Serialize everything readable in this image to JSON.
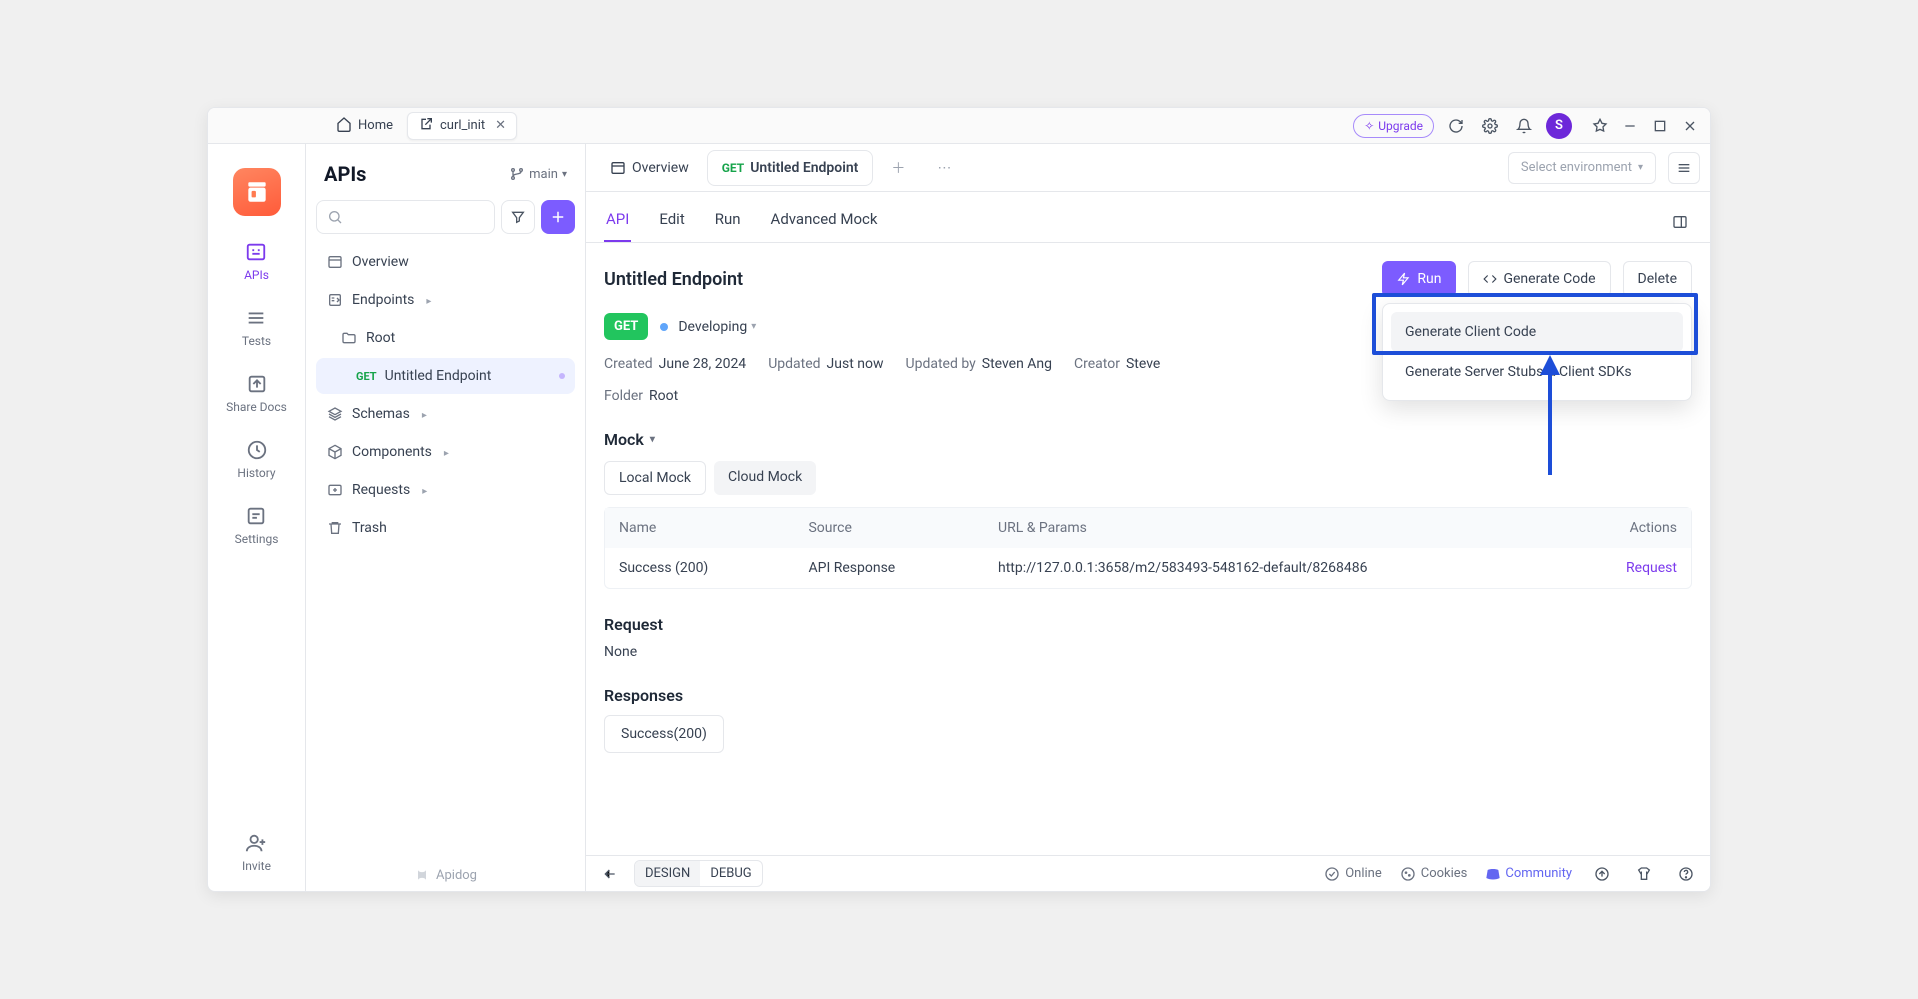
{
  "titlebar": {
    "home": "Home",
    "activeTab": "curl_init",
    "upgrade": "Upgrade",
    "avatarInitial": "S"
  },
  "rail": {
    "items": [
      "APIs",
      "Tests",
      "Share Docs",
      "History",
      "Settings",
      "Invite"
    ]
  },
  "sidebar": {
    "title": "APIs",
    "branch": "main",
    "tree": {
      "overview": "Overview",
      "endpoints": "Endpoints",
      "root": "Root",
      "endpointMethod": "GET",
      "endpointName": "Untitled Endpoint",
      "schemas": "Schemas",
      "components": "Components",
      "requests": "Requests",
      "trash": "Trash"
    },
    "brand": "Apidog"
  },
  "mainTabs": {
    "overview": "Overview",
    "endpointMethod": "GET",
    "endpointLabel": "Untitled Endpoint",
    "envPlaceholder": "Select environment"
  },
  "subtabs": [
    "API",
    "Edit",
    "Run",
    "Advanced Mock"
  ],
  "endpoint": {
    "title": "Untitled Endpoint",
    "run": "Run",
    "generate": "Generate Code",
    "delete": "Delete",
    "method": "GET",
    "status": "Developing",
    "created": {
      "label": "Created",
      "value": "June 28, 2024"
    },
    "updated": {
      "label": "Updated",
      "value": "Just now"
    },
    "updatedBy": {
      "label": "Updated by",
      "value": "Steven Ang"
    },
    "creator": {
      "label": "Creator",
      "value": "Steve"
    },
    "folder": {
      "label": "Folder",
      "value": "Root"
    }
  },
  "dropdown": {
    "item1": "Generate Client Code",
    "item2": "Generate Server Stubs & Client SDKs"
  },
  "mock": {
    "title": "Mock",
    "local": "Local Mock",
    "cloud": "Cloud Mock",
    "headers": {
      "name": "Name",
      "source": "Source",
      "url": "URL & Params",
      "actions": "Actions"
    },
    "row": {
      "name": "Success (200)",
      "source": "API Response",
      "url": "http://127.0.0.1:3658/m2/583493-548162-default/8268486",
      "action": "Request"
    }
  },
  "request": {
    "title": "Request",
    "body": "None"
  },
  "responses": {
    "title": "Responses",
    "pill": "Success(200)"
  },
  "statusbar": {
    "design": "DESIGN",
    "debug": "DEBUG",
    "online": "Online",
    "cookies": "Cookies",
    "community": "Community"
  }
}
